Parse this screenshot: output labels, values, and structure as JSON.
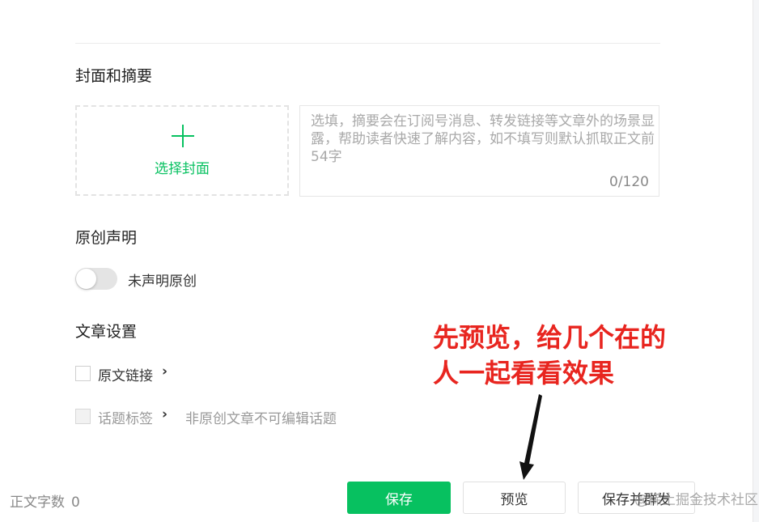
{
  "cover_summary": {
    "title": "封面和摘要",
    "cover_button_label": "选择封面",
    "summary_placeholder": "选填，摘要会在订阅号消息、转发链接等文章外的场景显露，帮助读者快速了解内容，如不填写则默认抓取正文前54字",
    "summary_count": "0/120"
  },
  "original": {
    "title": "原创声明",
    "toggle_label": "未声明原创",
    "toggle_on": false
  },
  "article_settings": {
    "title": "文章设置",
    "source_link_label": "原文链接",
    "topic_tag_label": "话题标签",
    "topic_tag_hint": "非原创文章不可编辑话题",
    "chevron": "›"
  },
  "annotation": {
    "text_line1": "先预览，给几个在的",
    "text_line2": "人一起看看效果",
    "color": "#e8251f"
  },
  "footer": {
    "word_count_label": "正文字数",
    "word_count_value": "0",
    "save_label": "保存",
    "preview_label": "预览",
    "publish_label": "保存并群发",
    "watermark": "@稀土掘金技术社区"
  },
  "colors": {
    "accent": "#07c160"
  }
}
